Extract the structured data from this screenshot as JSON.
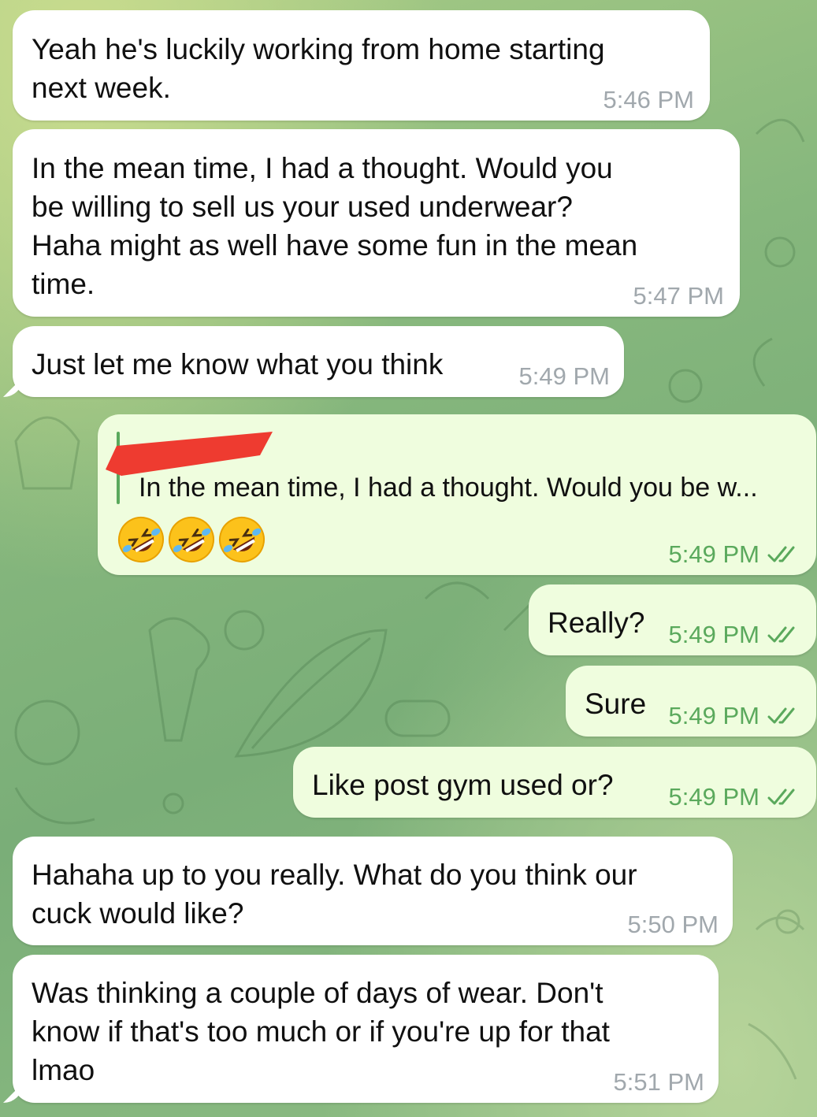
{
  "messages": [
    {
      "text": "Yeah he's luckily working from home starting\nnext week.",
      "time": "5:46 PM"
    },
    {
      "text": "In the mean time, I had a thought. Would you\nbe willing to sell us your used underwear?\nHaha might as well have some fun in the mean\ntime.",
      "time": "5:47 PM"
    },
    {
      "text": "Just let me know what you think",
      "time": "5:49 PM"
    },
    {
      "reply_quote": "In the mean time, I had a thought. Would you be w...",
      "emoji": "🤣🤣🤣",
      "time": "5:49 PM",
      "status": "read"
    },
    {
      "text": "Really?",
      "time": "5:49 PM",
      "status": "read"
    },
    {
      "text": "Sure",
      "time": "5:49 PM",
      "status": "read"
    },
    {
      "text": "Like post gym used or?",
      "time": "5:49 PM",
      "status": "read"
    },
    {
      "text": "Hahaha up to you really. What do you think our\ncuck would like?",
      "time": "5:50 PM"
    },
    {
      "text": "Was thinking a couple of days of wear. Don't\nknow if that's too much or if you're up for that\nlmao",
      "time": "5:51 PM"
    }
  ],
  "colors": {
    "incoming_bubble": "#ffffff",
    "outgoing_bubble": "#effdde",
    "outgoing_time": "#5aa95c",
    "incoming_time": "#a1a8ad",
    "redaction": "#ee3b30"
  },
  "icons": {
    "read_status": "double-check-icon",
    "emoji": "rolling-on-floor-laughing"
  }
}
